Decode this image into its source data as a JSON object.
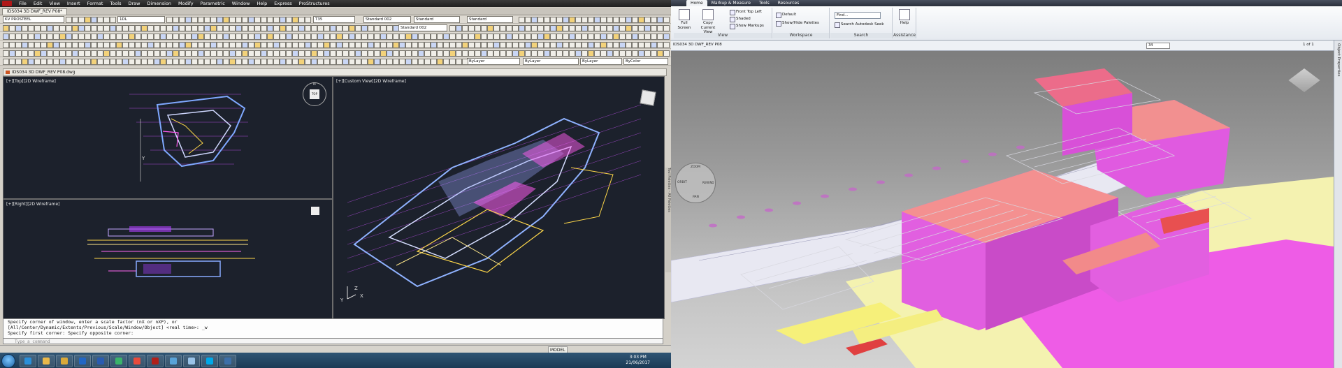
{
  "cad": {
    "menu": [
      "File",
      "Edit",
      "View",
      "Insert",
      "Format",
      "Tools",
      "Draw",
      "Dimension",
      "Modify",
      "Parametric",
      "Window",
      "Help",
      "Express",
      "ProStructures"
    ],
    "document_tab": "IDS034 3D DWF_REV P08*",
    "combos": {
      "workspace": "KV PROSTEEL",
      "layer_state": "1DL",
      "text_height": "T35",
      "text_style": "Standard 002",
      "dim_style": "Standard",
      "table_style": "Standard",
      "multileader_style": "Standard 002",
      "layer": "ByLayer",
      "linetype": "ByLayer",
      "lineweight": "ByLayer",
      "color": "ByColor"
    },
    "drawing_title": "IDS034 3D DWF_REV P08.dwg",
    "viewports": {
      "top": "[+][Top][2D Wireframe]",
      "right": "[+][Right][2D Wireframe]",
      "custom": "[+][Custom View][2D Wireframe]"
    },
    "viewcube_top_label": "TOP",
    "compass": {
      "n": "N"
    },
    "command_history": [
      "Specify corner of window, enter a scale factor (nX or nXP), or",
      "[All/Center/Dynamic/Extents/Previous/Scale/Window/Object] <real time>: _w",
      "Specify first corner: Specify opposite corner:"
    ],
    "command_prompt": "Type a command",
    "status_model": "MODEL",
    "tool_palettes": "Tool Palettes - All Palettes",
    "ucs_labels": {
      "x": "X",
      "y": "Y",
      "z": "Z"
    }
  },
  "taskbar": {
    "clock_time": "3:03 PM",
    "clock_date": "21/06/2017",
    "apps": [
      {
        "name": "ie-icon",
        "color": "#2b8fd9"
      },
      {
        "name": "explorer-icon",
        "color": "#e9b84a"
      },
      {
        "name": "folder-icon",
        "color": "#d9a93a"
      },
      {
        "name": "outlook-icon",
        "color": "#2266c4"
      },
      {
        "name": "word-icon",
        "color": "#2a5bb0"
      },
      {
        "name": "viewer-icon",
        "color": "#3bb36a"
      },
      {
        "name": "chrome-icon",
        "color": "#e84b3c"
      },
      {
        "name": "autocad-icon",
        "color": "#b0201a"
      },
      {
        "name": "app-icon",
        "color": "#59a3d8"
      },
      {
        "name": "app2-icon",
        "color": "#9ac3e8"
      },
      {
        "name": "skype-icon",
        "color": "#00a8e8"
      },
      {
        "name": "navisworks-icon",
        "color": "#3d6fa8"
      }
    ]
  },
  "viewer": {
    "tabs": [
      "Home",
      "Markup & Measure",
      "Tools",
      "Resources"
    ],
    "active_tab": "Home",
    "view_group": {
      "name": "View",
      "full_screen": "Full Screen",
      "copy_view": "Copy Current View",
      "front_top_left": "Front Top Left",
      "shaded": "Shaded",
      "show_markups": "Show Markups"
    },
    "workspace_group": {
      "name": "Workspace",
      "default": "Default",
      "show_hide": "Show/Hide Palettes"
    },
    "search_group": {
      "name": "Search",
      "find": "Find...",
      "seek": "Search Autodesk Seek"
    },
    "assistance_group": {
      "name": "Assistance",
      "help": "Help"
    },
    "doc_name": "IDS034 3D DWF_REV P08",
    "zoom": "34",
    "page": "1 of 1",
    "object_properties": "Object Properties",
    "steering_wheel": {
      "top": "ZOOM",
      "left": "ORBIT",
      "bottom": "PAN",
      "right": "REWIND"
    }
  }
}
